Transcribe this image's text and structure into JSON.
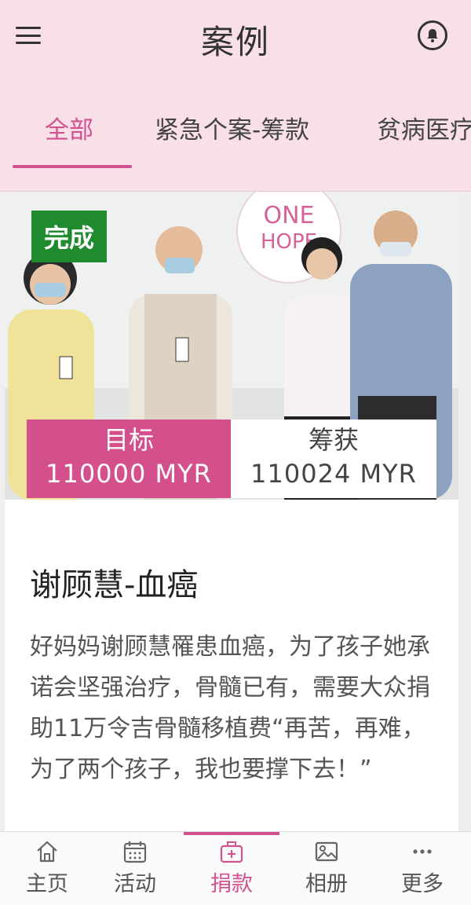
{
  "header": {
    "title": "案例",
    "menu_icon": "hamburger-menu-icon",
    "bell_icon": "bell-icon"
  },
  "tabs": [
    {
      "label": "全部",
      "active": true
    },
    {
      "label": "紧急个案-筹款",
      "active": false
    },
    {
      "label": "贫病医疗",
      "active": false
    }
  ],
  "case": {
    "status": "完成",
    "target_label": "目标",
    "target_value": "110000 MYR",
    "raised_label": "筹获",
    "raised_value": "110024 MYR",
    "title": "谢顾慧-血癌",
    "description": "好妈妈谢顾慧罹患血癌，为了孩子她承诺会坚强治疗，骨髓已有，需要大众捐助11万令吉骨髓移植费“再苦，再难，为了两个孩子，我也要撑下去！”",
    "photo_logo_line1": "ONE",
    "photo_logo_line2": "HOPE"
  },
  "bottom_nav": [
    {
      "label": "主页",
      "icon": "home-icon",
      "active": false
    },
    {
      "label": "活动",
      "icon": "calendar-icon",
      "active": false
    },
    {
      "label": "捐款",
      "icon": "donation-box-icon",
      "active": true
    },
    {
      "label": "相册",
      "icon": "photo-album-icon",
      "active": false
    },
    {
      "label": "更多",
      "icon": "more-dots-icon",
      "active": false
    }
  ],
  "colors": {
    "header_bg": "#f9dfe7",
    "accent": "#d0538f",
    "status_green": "#1f8a2e"
  }
}
